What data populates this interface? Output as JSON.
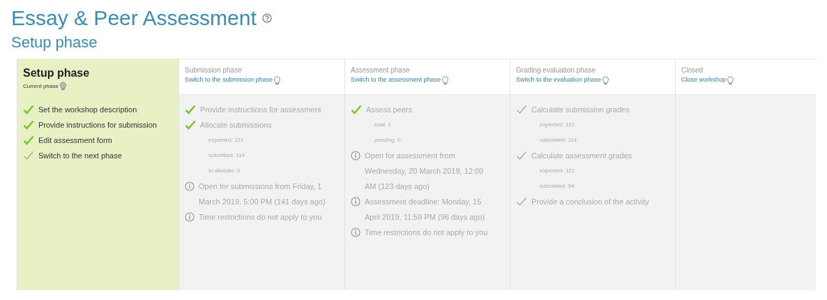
{
  "page_title": "Essay & Peer Assessment",
  "phase_heading": "Setup phase",
  "phases": [
    {
      "title": "Setup phase",
      "selected": true,
      "action": "Current phase",
      "tasks": [
        {
          "kind": "task",
          "done": true,
          "text": "Set the workshop description"
        },
        {
          "kind": "task",
          "done": true,
          "text": "Provide instructions for submission"
        },
        {
          "kind": "task",
          "done": true,
          "text": "Edit assessment form"
        },
        {
          "kind": "task",
          "done": false,
          "text": "Switch to the next phase"
        }
      ]
    },
    {
      "title": "Submission phase",
      "selected": false,
      "action": "Switch to the submission phase",
      "tasks": [
        {
          "kind": "task",
          "done": true,
          "text": "Provide instructions for assessment"
        },
        {
          "kind": "task",
          "done": true,
          "text": "Allocate submissions",
          "details": [
            "expected: 121",
            "submitted: 114",
            "to allocate: 0"
          ]
        },
        {
          "kind": "info",
          "text": "Open for submissions from Friday, 1 March 2019, 5:00 PM (141 days ago)"
        },
        {
          "kind": "info",
          "text": "Time restrictions do not apply to you"
        }
      ]
    },
    {
      "title": "Assessment phase",
      "selected": false,
      "action": "Switch to the assessment phase",
      "tasks": [
        {
          "kind": "task",
          "done": true,
          "text": "Assess peers",
          "details": [
            "total: 1",
            "pending: 0"
          ]
        },
        {
          "kind": "info",
          "text": "Open for assessment from Wednesday, 20 March 2019, 12:00 AM (123 days ago)"
        },
        {
          "kind": "info",
          "text": "Assessment deadline: Monday, 15 April 2019, 11:59 PM (96 days ago)"
        },
        {
          "kind": "info",
          "text": "Time restrictions do not apply to you"
        }
      ]
    },
    {
      "title": "Grading evaluation phase",
      "selected": false,
      "action": "Switch to the evaluation phase",
      "tasks": [
        {
          "kind": "task",
          "done": false,
          "text": "Calculate submission grades",
          "details": [
            "expected: 121",
            "calculated: 114"
          ]
        },
        {
          "kind": "task",
          "done": false,
          "text": "Calculate assessment grades",
          "details": [
            "expected: 121",
            "calculated: 94"
          ]
        },
        {
          "kind": "task",
          "done": false,
          "text": "Provide a conclusion of the activity"
        }
      ]
    },
    {
      "title": "Closed",
      "selected": false,
      "action": "Close workshop"
    }
  ]
}
